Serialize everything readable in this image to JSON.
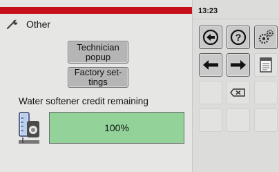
{
  "header": {
    "title": "Other",
    "icon": "wrench-icon"
  },
  "status": {
    "time": "13:23",
    "accent_color": "#c8101b"
  },
  "buttons": {
    "technician_popup": "Technician popup",
    "factory_settings": "Factory set-tings"
  },
  "softener": {
    "label": "Water softener credit remaining",
    "value_text": "100%",
    "value_fraction": 1.0,
    "fill_color": "#93d39a",
    "icon": "water-softener-icon"
  },
  "keypad": {
    "row1": [
      "back-circle-icon",
      "help-icon",
      "settings-gears-icon"
    ],
    "row2": [
      "arrow-left-icon",
      "arrow-right-icon",
      "document-icon"
    ],
    "row3": [
      "empty",
      "backspace-icon",
      "empty"
    ],
    "row4": [
      "empty",
      "empty",
      "empty"
    ]
  }
}
